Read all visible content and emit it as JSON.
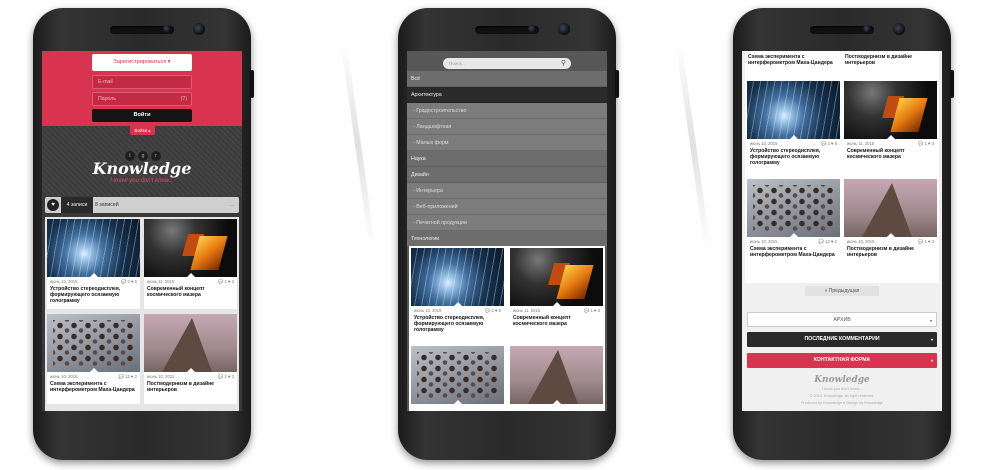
{
  "posts": [
    {
      "date": "июнь 13, 2015",
      "comments": "2",
      "likes": "5",
      "title": "Устройство стереодисплея, формирующего осязаемую голограмму"
    },
    {
      "date": "июнь 11, 2015",
      "comments": "1",
      "likes": "3",
      "title": "Современный концепт космического мазера"
    },
    {
      "date": "июнь 10, 2015",
      "comments": "12",
      "likes": "2",
      "title": "Схема эксперимента с интерферометром Маха-Цандера"
    },
    {
      "date": "июнь 10, 2015",
      "comments": "1",
      "likes": "3",
      "title": "Постмодернизм в дизайне интерьеров"
    }
  ],
  "phone1": {
    "register_label": "Зарегистрироваться ▾",
    "email_placeholder": "E-mail",
    "password_placeholder": "Пароль",
    "password_hint": "(?)",
    "login_label": "Войти",
    "login_tab": "Войти ▴",
    "brand": "Knowledge",
    "tagline": "I know you don't know...",
    "social": [
      "t",
      "g",
      "r"
    ],
    "toolbar": {
      "view_a": "4 записи",
      "view_b": "8 записей",
      "more": "…"
    }
  },
  "phone2": {
    "search_placeholder": "Поиск...",
    "menu": [
      {
        "label": "Всё",
        "style": "mid"
      },
      {
        "label": "Архитектура",
        "style": "dark"
      },
      {
        "label": "- Градостроительство",
        "style": "light"
      },
      {
        "label": "- Ландшафтная",
        "style": "light"
      },
      {
        "label": "- Малых форм",
        "style": "light"
      },
      {
        "label": "Наука",
        "style": "mid"
      },
      {
        "label": "Дизайн",
        "style": "mid"
      },
      {
        "label": "- Интерьера",
        "style": "light"
      },
      {
        "label": "- Веб-приложений",
        "style": "light"
      },
      {
        "label": "- Печатной продукции",
        "style": "light"
      },
      {
        "label": "Технологии",
        "style": "mid"
      }
    ]
  },
  "phone3": {
    "prev_label": "« Предыдущая",
    "archive_label": "АРХИВ",
    "comments_label": "ПОСЛЕДНИЕ КОММЕНТАРИИ",
    "contact_label": "КОНТАКТНАЯ ФОРМА",
    "footer_brand": "Knowledge",
    "footer_tagline": "I know you don't know...",
    "footer_copy": "© 2015, Knowledge. All right reserved.",
    "footer_credit": "Produced by Knowledge ● Design by Knowledge"
  },
  "colors": {
    "accent": "#d9344f",
    "dark": "#2a2a2a",
    "menu": "#6d6d6d"
  }
}
